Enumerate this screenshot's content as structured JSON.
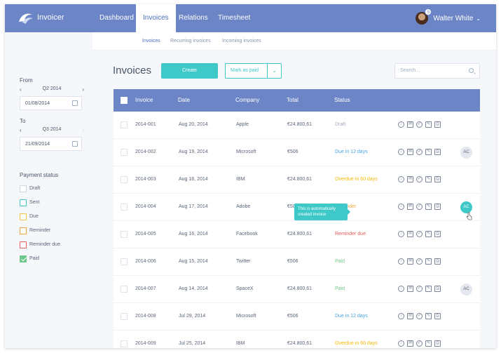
{
  "app": {
    "name": "Invoicer"
  },
  "nav": [
    {
      "label": "Dashboard",
      "active": false
    },
    {
      "label": "Invoices",
      "active": true
    },
    {
      "label": "Relations",
      "active": false
    },
    {
      "label": "Timesheet",
      "active": false
    }
  ],
  "user": {
    "name": "Walter White",
    "badge": "5"
  },
  "subnav": [
    {
      "label": "Invoices",
      "active": true
    },
    {
      "label": "Recurring invoices",
      "active": false
    },
    {
      "label": "Incoming invoices",
      "active": false
    }
  ],
  "filters": {
    "from_label": "From",
    "from_quarter": "Q2 2014",
    "from_date": "01/08/2014",
    "to_label": "To",
    "to_quarter": "Q3 2014",
    "to_date": "21/09/2014",
    "payment_status_label": "Payment status",
    "statuses": [
      {
        "label": "Draft",
        "color": "#cfd6e0",
        "checked": false
      },
      {
        "label": "Sent",
        "color": "#3ec8c8",
        "checked": false
      },
      {
        "label": "Due",
        "color": "#f6c343",
        "checked": false
      },
      {
        "label": "Reminder",
        "color": "#f6a243",
        "checked": false
      },
      {
        "label": "Reminder due",
        "color": "#e55a5a",
        "checked": false
      },
      {
        "label": "Paid",
        "color": "#6cc98b",
        "checked": true
      }
    ]
  },
  "main": {
    "title": "Invoices",
    "create_label": "Create",
    "mark_paid_label": "Mark as paid",
    "search_placeholder": "Search..."
  },
  "table": {
    "headers": {
      "invoice": "Invoice",
      "date": "Date",
      "company": "Company",
      "total": "Total",
      "status": "Status"
    },
    "rows": [
      {
        "invoice": "2014-001",
        "date": "Aug 20, 2014",
        "company": "Apple",
        "total": "€24.800,61",
        "status": "Draft",
        "status_color": "#a0aec0",
        "assignee": ""
      },
      {
        "invoice": "2014-002",
        "date": "Aug 19, 2014",
        "company": "Microsoft",
        "total": "€506",
        "status": "Due in 12 days",
        "status_color": "#4aa3df",
        "assignee": "AC"
      },
      {
        "invoice": "2014-003",
        "date": "Aug 18, 2014",
        "company": "IBM",
        "total": "€24.800,61",
        "status": "Overdue in 60 days",
        "status_color": "#f6b800",
        "assignee": ""
      },
      {
        "invoice": "2014-004",
        "date": "Aug 17, 2014",
        "company": "Adobe",
        "total": "€506",
        "status": "Reminder",
        "status_color": "#f6a243",
        "assignee": "AC"
      },
      {
        "invoice": "2014-005",
        "date": "Aug 16, 2014",
        "company": "Facebook",
        "total": "€24.800,61",
        "status": "Reminder due",
        "status_color": "#e55a5a",
        "assignee": ""
      },
      {
        "invoice": "2014-006",
        "date": "Aug 15, 2014",
        "company": "Twitter",
        "total": "€506",
        "status": "Paid",
        "status_color": "#6cc98b",
        "assignee": ""
      },
      {
        "invoice": "2014-007",
        "date": "Aug 14, 2014",
        "company": "SpaceX",
        "total": "€24.800,61",
        "status": "Paid",
        "status_color": "#6cc98b",
        "assignee": "AC"
      },
      {
        "invoice": "2014-008",
        "date": "Jul 29, 2014",
        "company": "Microsoft",
        "total": "€506",
        "status": "Due in 12 days",
        "status_color": "#4aa3df",
        "assignee": ""
      },
      {
        "invoice": "2014-009",
        "date": "Jul 25, 2014",
        "company": "IBM",
        "total": "€24.800,61",
        "status": "Overdue in 60 days",
        "status_color": "#f6b800",
        "assignee": ""
      }
    ],
    "tooltip": "This is automatically created invoice"
  },
  "icons": {
    "action_icons": [
      "download-icon",
      "mail-icon",
      "check-circle-icon",
      "edit-icon",
      "print-icon"
    ]
  }
}
